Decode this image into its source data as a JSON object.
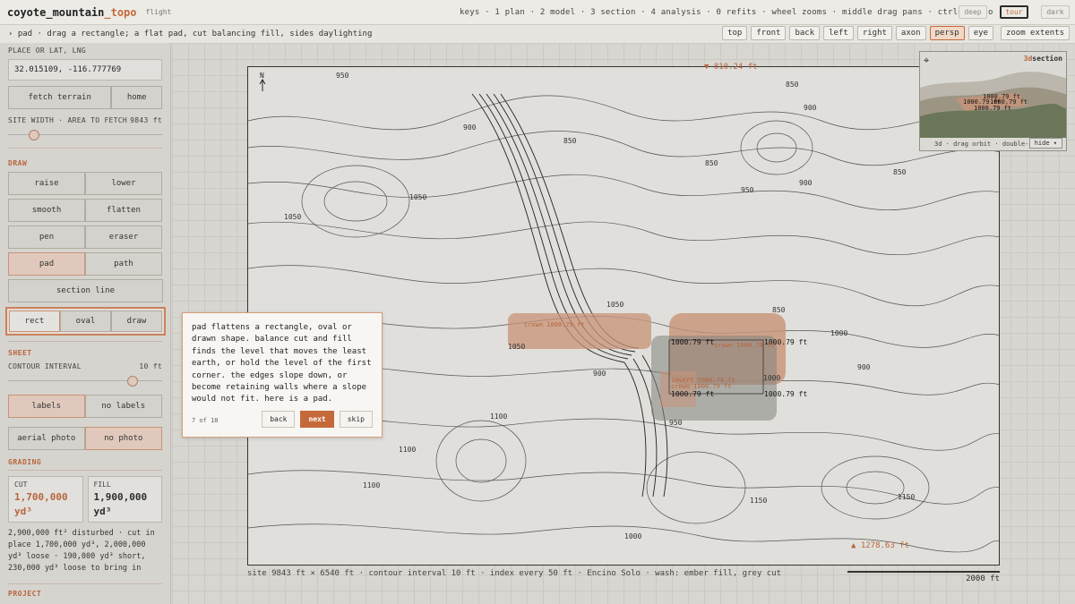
{
  "app": {
    "title_main": "coyote_mountain",
    "title_accent": "_topo",
    "subtitle": "flight"
  },
  "keys_hint": "keys · 1 plan · 2 model · 3 section · 4 analysis · 0 refits · wheel zooms · middle drag pans · ctrl+z undo",
  "modes": [
    {
      "label": "deep"
    },
    {
      "label": "tour"
    },
    {
      "label": "dark"
    }
  ],
  "hint": "› pad · drag a rectangle; a flat pad, cut balancing fill, sides daylighting",
  "views": [
    {
      "label": "top"
    },
    {
      "label": "front"
    },
    {
      "label": "back"
    },
    {
      "label": "left"
    },
    {
      "label": "right"
    },
    {
      "label": "axon"
    },
    {
      "label": "persp"
    },
    {
      "label": "eye"
    }
  ],
  "zoom_extents": "zoom extents",
  "sidebar": {
    "place_label": "PLACE OR LAT, LNG",
    "place_value": "32.015109, -116.777769",
    "fetch": "fetch terrain",
    "home": "home",
    "site_width_label": "SITE WIDTH · AREA TO FETCH",
    "site_width_value": "9843 ft",
    "site_width_level": 0.17,
    "draw_title": "DRAW",
    "tools": [
      "raise",
      "lower",
      "smooth",
      "flatten",
      "pen",
      "eraser",
      "pad",
      "path"
    ],
    "section_line": "section line",
    "shapes": [
      "rect",
      "oval",
      "draw"
    ],
    "sheet_title": "SHEET",
    "contour_label": "CONTOUR INTERVAL",
    "contour_value": "10 ft",
    "contour_level": 0.81,
    "labels": "labels",
    "no_labels": "no labels",
    "aerial": "aerial photo",
    "no_photo": "no photo",
    "grading_title": "GRADING",
    "cut_label": "CUT",
    "cut_value": "1,700,000 yd³",
    "fill_label": "FILL",
    "fill_value": "1,900,000 yd³",
    "grading_summary": "2,900,000 ft² disturbed · cut in place 1,700,000 yd³, 2,000,000 yd³ loose · 190,000 yd³ short, 230,000 yd³ loose to bring in",
    "project_title": "PROJECT"
  },
  "map": {
    "north": "N",
    "contour_labels": [
      "950",
      "850",
      "900",
      "850",
      "850",
      "900",
      "1050",
      "1050",
      "850",
      "1000",
      "1050",
      "900",
      "1100",
      "1050",
      "850",
      "900",
      "1100",
      "950",
      "1000",
      "1150",
      "1150",
      "1000",
      "1100",
      "950",
      "900"
    ],
    "low_point": "▼ 810.24 ft",
    "high_point": "▲ 1278.63 ft",
    "pad_labels": [
      "1000.79 ft",
      "1000.79 ft",
      "1000.79 ft",
      "1000.79 ft"
    ],
    "crown_left": "crown 1000.79 ft",
    "crown_right": "crown 1000.79 ft",
    "invert": "invert 1000.79 ft",
    "crown_low": "crown 1000.79 ft",
    "footer": "site 9843 ft × 6540 ft · contour interval 10 ft · index every 50 ft · Encino Solo · wash: ember fill, grey cut",
    "scale": "2000 ft"
  },
  "minimap": {
    "title_a": "3d",
    "title_b": "section",
    "footer": "3d · drag orbit · double-",
    "hide": "hide ▾",
    "pad_labels": [
      "1000.79 ft",
      "1000.79 ft",
      "1000.79 ft",
      "1000.79 ft"
    ]
  },
  "tour": {
    "text": "pad flattens a rectangle, oval or drawn shape. balance cut and fill finds the level that moves the least earth, or hold the level of the first corner. the edges slope down, or become retaining walls where a slope would not fit. here is a pad.",
    "step": "7 of 18",
    "back": "back",
    "next": "next",
    "skip": "skip"
  },
  "colors": {
    "accent": "#c5693b",
    "fill_wash": "#d79c7d",
    "cut_wash": "#8a8a86"
  }
}
